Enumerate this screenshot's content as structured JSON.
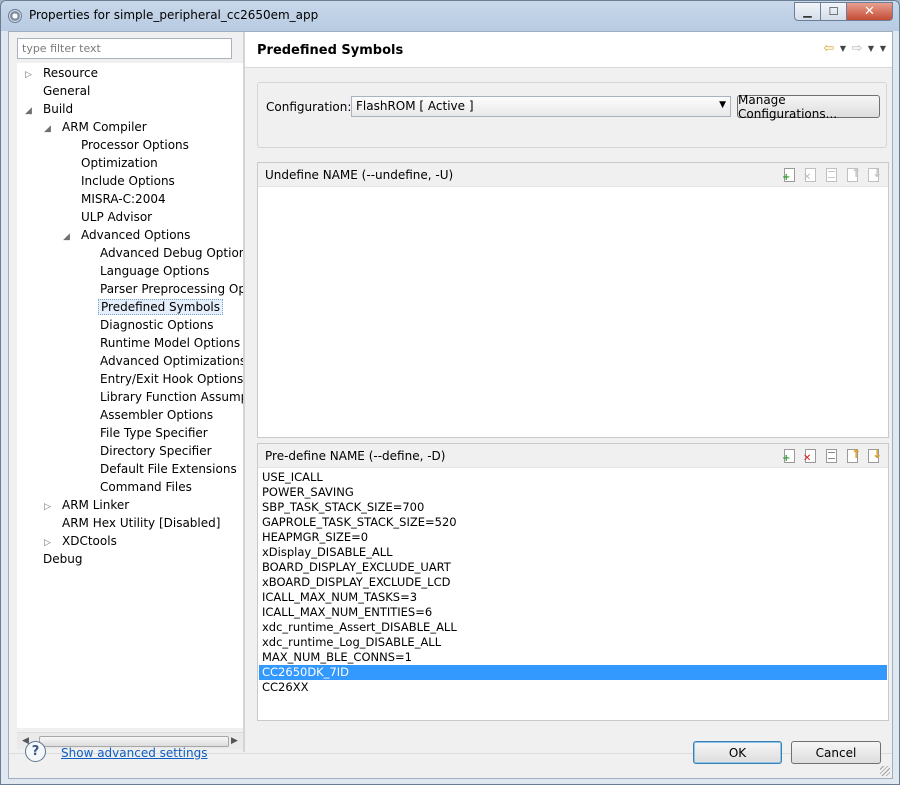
{
  "window": {
    "title": "Properties for simple_peripheral_cc2650em_app"
  },
  "filter": {
    "placeholder": "type filter text"
  },
  "tree": {
    "items": [
      {
        "label": "Resource",
        "level": 0,
        "toggle": "collapsed"
      },
      {
        "label": "General",
        "level": 0,
        "toggle": "none"
      },
      {
        "label": "Build",
        "level": 0,
        "toggle": "expanded"
      },
      {
        "label": "ARM Compiler",
        "level": 1,
        "toggle": "expanded"
      },
      {
        "label": "Processor Options",
        "level": 2,
        "toggle": "none"
      },
      {
        "label": "Optimization",
        "level": 2,
        "toggle": "none"
      },
      {
        "label": "Include Options",
        "level": 2,
        "toggle": "none"
      },
      {
        "label": "MISRA-C:2004",
        "level": 2,
        "toggle": "none"
      },
      {
        "label": "ULP Advisor",
        "level": 2,
        "toggle": "none"
      },
      {
        "label": "Advanced Options",
        "level": 2,
        "toggle": "expanded"
      },
      {
        "label": "Advanced Debug Options",
        "level": 3,
        "toggle": "none"
      },
      {
        "label": "Language Options",
        "level": 3,
        "toggle": "none"
      },
      {
        "label": "Parser Preprocessing Opti",
        "level": 3,
        "toggle": "none"
      },
      {
        "label": "Predefined Symbols",
        "level": 3,
        "toggle": "none",
        "selected": true
      },
      {
        "label": "Diagnostic Options",
        "level": 3,
        "toggle": "none"
      },
      {
        "label": "Runtime Model Options",
        "level": 3,
        "toggle": "none"
      },
      {
        "label": "Advanced Optimizations",
        "level": 3,
        "toggle": "none"
      },
      {
        "label": "Entry/Exit Hook Options",
        "level": 3,
        "toggle": "none"
      },
      {
        "label": "Library Function Assumpt",
        "level": 3,
        "toggle": "none"
      },
      {
        "label": "Assembler Options",
        "level": 3,
        "toggle": "none"
      },
      {
        "label": "File Type Specifier",
        "level": 3,
        "toggle": "none"
      },
      {
        "label": "Directory Specifier",
        "level": 3,
        "toggle": "none"
      },
      {
        "label": "Default File Extensions",
        "level": 3,
        "toggle": "none"
      },
      {
        "label": "Command Files",
        "level": 3,
        "toggle": "none"
      },
      {
        "label": "ARM Linker",
        "level": 1,
        "toggle": "collapsed"
      },
      {
        "label": "ARM Hex Utility  [Disabled]",
        "level": 1,
        "toggle": "none"
      },
      {
        "label": "XDCtools",
        "level": 1,
        "toggle": "collapsed"
      },
      {
        "label": "Debug",
        "level": 0,
        "toggle": "none"
      }
    ]
  },
  "page": {
    "title": "Predefined Symbols"
  },
  "config": {
    "label": "Configuration:",
    "value": "FlashROM  [ Active ]",
    "manage_label": "Manage Configurations..."
  },
  "undefine": {
    "title": "Undefine NAME (--undefine, -U)",
    "items": []
  },
  "predefine": {
    "title": "Pre-define NAME (--define, -D)",
    "selected_index": 13,
    "items": [
      "USE_ICALL",
      "POWER_SAVING",
      "SBP_TASK_STACK_SIZE=700",
      "GAPROLE_TASK_STACK_SIZE=520",
      "HEAPMGR_SIZE=0",
      "xDisplay_DISABLE_ALL",
      "BOARD_DISPLAY_EXCLUDE_UART",
      "xBOARD_DISPLAY_EXCLUDE_LCD",
      "ICALL_MAX_NUM_TASKS=3",
      "ICALL_MAX_NUM_ENTITIES=6",
      "xdc_runtime_Assert_DISABLE_ALL",
      "xdc_runtime_Log_DISABLE_ALL",
      "MAX_NUM_BLE_CONNS=1",
      "CC2650DK_7ID",
      "CC26XX"
    ]
  },
  "footer": {
    "help_symbol": "?",
    "advanced_link": "Show advanced settings",
    "ok_label": "OK",
    "cancel_label": "Cancel"
  },
  "glyphs": {
    "tree_collapsed": "▷",
    "tree_expanded": "◢",
    "minimize": "▁",
    "maximize": "☐",
    "close": "✕",
    "dropdown": "▼",
    "back": "⇦",
    "forward": "⇨"
  },
  "colors": {
    "selection": "#3399ff",
    "link": "#0c5dc4",
    "add_badge": "#2a9a2a",
    "delete_badge": "#d02020"
  }
}
